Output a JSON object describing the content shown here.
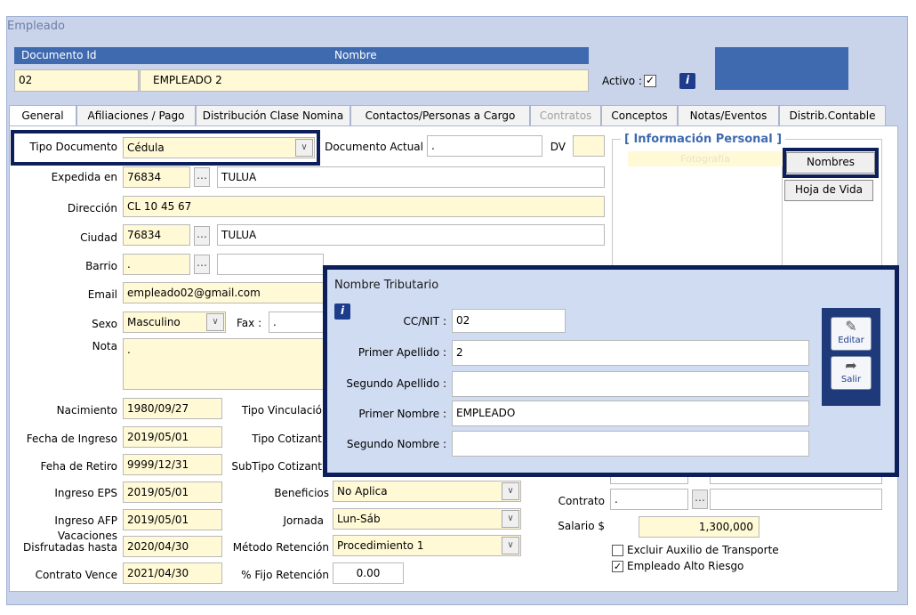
{
  "window": {
    "title": "Empleado"
  },
  "header": {
    "doc_id_label": "Documento Id",
    "nombre_label": "Nombre",
    "doc_id_value": "02",
    "nombre_value": "EMPLEADO 2",
    "activo_label": "Activo :",
    "activo_check": "✓",
    "info_icon": "i"
  },
  "tabs": [
    {
      "label": "General"
    },
    {
      "label": "Afiliaciones / Pago"
    },
    {
      "label": "Distribución Clase Nomina"
    },
    {
      "label": "Contactos/Personas a Cargo"
    },
    {
      "label": "Contratos"
    },
    {
      "label": "Conceptos"
    },
    {
      "label": "Notas/Eventos"
    },
    {
      "label": "Distrib.Contable"
    }
  ],
  "form": {
    "tipo_documento_label": "Tipo Documento",
    "tipo_documento_value": "Cédula",
    "documento_actual_label": "Documento Actual",
    "documento_actual_value": ".",
    "dv_label": "DV",
    "expedida_label": "Expedida en",
    "expedida_code": "76834",
    "expedida_city": "TULUA",
    "direccion_label": "Dirección",
    "direccion_value": "CL 10 45 67",
    "ciudad_label": "Ciudad",
    "ciudad_code": "76834",
    "ciudad_name": "TULUA",
    "barrio_label": "Barrio",
    "barrio_value": ".",
    "email_label": "Email",
    "email_value": "empleado02@gmail.com",
    "sexo_label": "Sexo",
    "sexo_value": "Masculino",
    "fax_label": "Fax :",
    "fax_value": ".",
    "nota_label": "Nota",
    "nota_value": ".",
    "nacimiento_label": "Nacimiento",
    "nacimiento_value": "1980/09/27",
    "ingreso_label": "Fecha de Ingreso",
    "ingreso_value": "2019/05/01",
    "retiro_label": "Feha de Retiro",
    "retiro_value": "9999/12/31",
    "ingreso_eps_label": "Ingreso EPS",
    "ingreso_eps_value": "2019/05/01",
    "ingreso_afp_label": "Ingreso AFP",
    "ingreso_afp_value": "2019/05/01",
    "vacaciones_label_1": "Vacaciones",
    "vacaciones_label_2": "Disfrutadas hasta",
    "vacaciones_value": "2020/04/30",
    "contrato_vence_label": "Contrato Vence",
    "contrato_vence_value": "2021/04/30",
    "tipo_vinculacion_label": "Tipo Vinculació",
    "tipo_cotizante_label": "Tipo Cotizant",
    "subtipo_cotizante_label": "SubTipo Cotizant",
    "beneficios_label": "Beneficios",
    "beneficios_value": "No Aplica",
    "jornada_label": "Jornada",
    "jornada_value": "Lun-Sáb",
    "metodo_label": "Método Retención",
    "metodo_value": "Procedimiento 1",
    "fijo_label": "% Fijo Retención",
    "fijo_value": "0.00",
    "contrato_label": "Contrato",
    "contrato_value": ".",
    "salario_label": "Salario $",
    "salario_value": "1,300,000",
    "excluir_label": "Excluir Auxilio de Transporte",
    "alto_riesgo_label": "Empleado Alto Riesgo",
    "alto_riesgo_check": "✓"
  },
  "info_personal": {
    "title": "[ Información Personal ]",
    "foto_label": "Fotografía",
    "nombres_button": "Nombres",
    "hoja_vida_button": "Hoja de Vida"
  },
  "modal": {
    "title": "Nombre Tributario",
    "info_icon": "i",
    "ccnit_label": "CC/NIT :",
    "ccnit_value": "02",
    "primer_apellido_label": "Primer Apellido :",
    "primer_apellido_value": "2",
    "segundo_apellido_label": "Segundo Apellido :",
    "segundo_apellido_value": "",
    "primer_nombre_label": "Primer Nombre :",
    "primer_nombre_value": "EMPLEADO",
    "segundo_nombre_label": "Segundo Nombre :",
    "segundo_nombre_value": "",
    "editar_button": "Editar",
    "salir_button": "Salir"
  },
  "icons": {
    "dropdown": "chevron-down-icon",
    "ellipsis": "ellipsis-button",
    "edit": "edit-icon",
    "exit": "exit-icon"
  },
  "colors": {
    "header_blue": "#3f6ab0",
    "field_yellow": "#fff9d6",
    "navy_highlight": "#0d1f5a",
    "window_bg": "#c9d3ea"
  }
}
